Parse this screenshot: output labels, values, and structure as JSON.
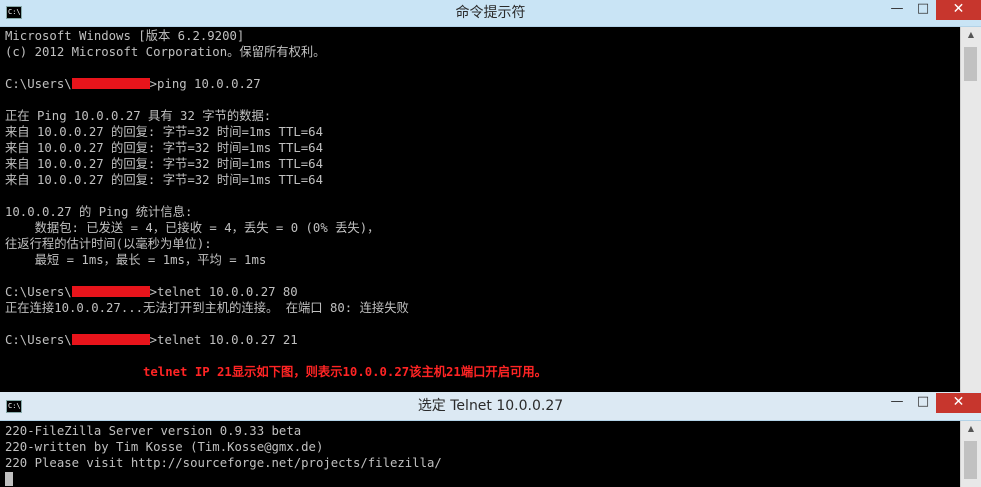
{
  "window1": {
    "icon_text": "C:\\",
    "title": "命令提示符",
    "controls": {
      "minimize": "—",
      "maximize": "□",
      "close": "✕"
    },
    "lines": [
      "Microsoft Windows [版本 6.2.9200]",
      "(c) 2012 Microsoft Corporation。保留所有权利。",
      "",
      {
        "prefix": "C:\\Users\\",
        "suffix": ">ping 10.0.0.27"
      },
      "",
      "正在 Ping 10.0.0.27 具有 32 字节的数据:",
      "来自 10.0.0.27 的回复: 字节=32 时间=1ms TTL=64",
      "来自 10.0.0.27 的回复: 字节=32 时间=1ms TTL=64",
      "来自 10.0.0.27 的回复: 字节=32 时间=1ms TTL=64",
      "来自 10.0.0.27 的回复: 字节=32 时间=1ms TTL=64",
      "",
      "10.0.0.27 的 Ping 统计信息:",
      "    数据包: 已发送 = 4，已接收 = 4，丢失 = 0 (0% 丢失)，",
      "往返行程的估计时间(以毫秒为单位):",
      "    最短 = 1ms，最长 = 1ms，平均 = 1ms",
      "",
      {
        "prefix": "C:\\Users\\",
        "suffix": ">telnet 10.0.0.27 80"
      },
      "正在连接10.0.0.27...无法打开到主机的连接。 在端口 80: 连接失败",
      "",
      {
        "prefix": "C:\\Users\\",
        "suffix": ">telnet 10.0.0.27 21"
      },
      ""
    ],
    "annotation": "telnet IP 21显示如下图，则表示10.0.0.27该主机21端口开启可用。"
  },
  "window2": {
    "icon_text": "C:\\",
    "title": "选定 Telnet 10.0.0.27",
    "controls": {
      "minimize": "—",
      "maximize": "□",
      "close": "✕"
    },
    "lines": [
      "220-FileZilla Server version 0.9.33 beta",
      "220-written by Tim Kosse (Tim.Kosse@gmx.de)",
      "220 Please visit http://sourceforge.net/projects/filezilla/"
    ]
  },
  "scrollbar": {
    "up": "▲",
    "down": "▼"
  },
  "colors": {
    "redaction": "#e8141b",
    "annotation": "#ff2424",
    "console_text": "#c0c0c0",
    "close_button": "#c7362d"
  }
}
